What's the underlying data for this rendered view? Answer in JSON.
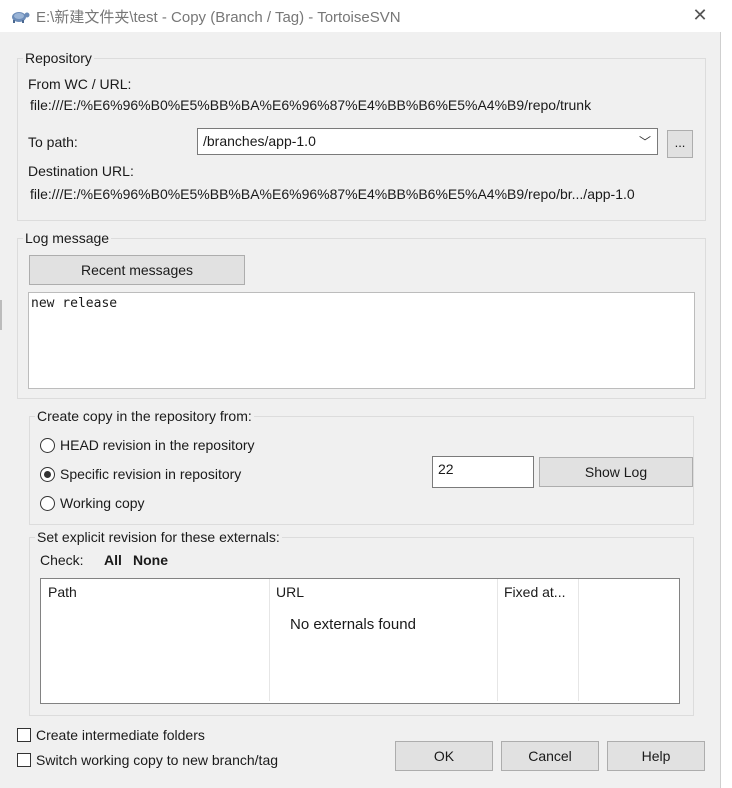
{
  "window": {
    "title": "E:\\新建文件夹\\test - Copy (Branch / Tag) - TortoiseSVN",
    "close_glyph": "✕",
    "app_icon": "tortoise-icon"
  },
  "repository": {
    "group_label": "Repository",
    "from_label": "From WC / URL:",
    "from_url": "file:///E:/%E6%96%B0%E5%BB%BA%E6%96%87%E4%BB%B6%E5%A4%B9/repo/trunk",
    "to_path_label": "To path:",
    "to_path_value": "/branches/app-1.0",
    "browse_label": "...",
    "dest_label": "Destination URL:",
    "dest_url": "file:///E:/%E6%96%B0%E5%BB%BA%E6%96%87%E4%BB%B6%E5%A4%B9/repo/br.../app-1.0"
  },
  "log": {
    "group_label": "Log message",
    "recent_button": "Recent messages",
    "message": "new release"
  },
  "copy_from": {
    "group_label": "Create copy in the repository from:",
    "options": [
      {
        "label": "HEAD revision in the repository",
        "checked": false
      },
      {
        "label": "Specific revision in repository",
        "checked": true
      },
      {
        "label": "Working copy",
        "checked": false
      }
    ],
    "revision_value": "22",
    "show_log_button": "Show Log"
  },
  "externals": {
    "group_label": "Set explicit revision for these externals:",
    "check_label": "Check:",
    "all_link": "All",
    "none_link": "None",
    "columns": [
      "Path",
      "URL",
      "Fixed at..."
    ],
    "empty_text": "No externals found"
  },
  "options": {
    "intermediate_folders": "Create intermediate folders",
    "switch_wc": "Switch working copy to new branch/tag"
  },
  "buttons": {
    "ok": "OK",
    "cancel": "Cancel",
    "help": "Help"
  }
}
